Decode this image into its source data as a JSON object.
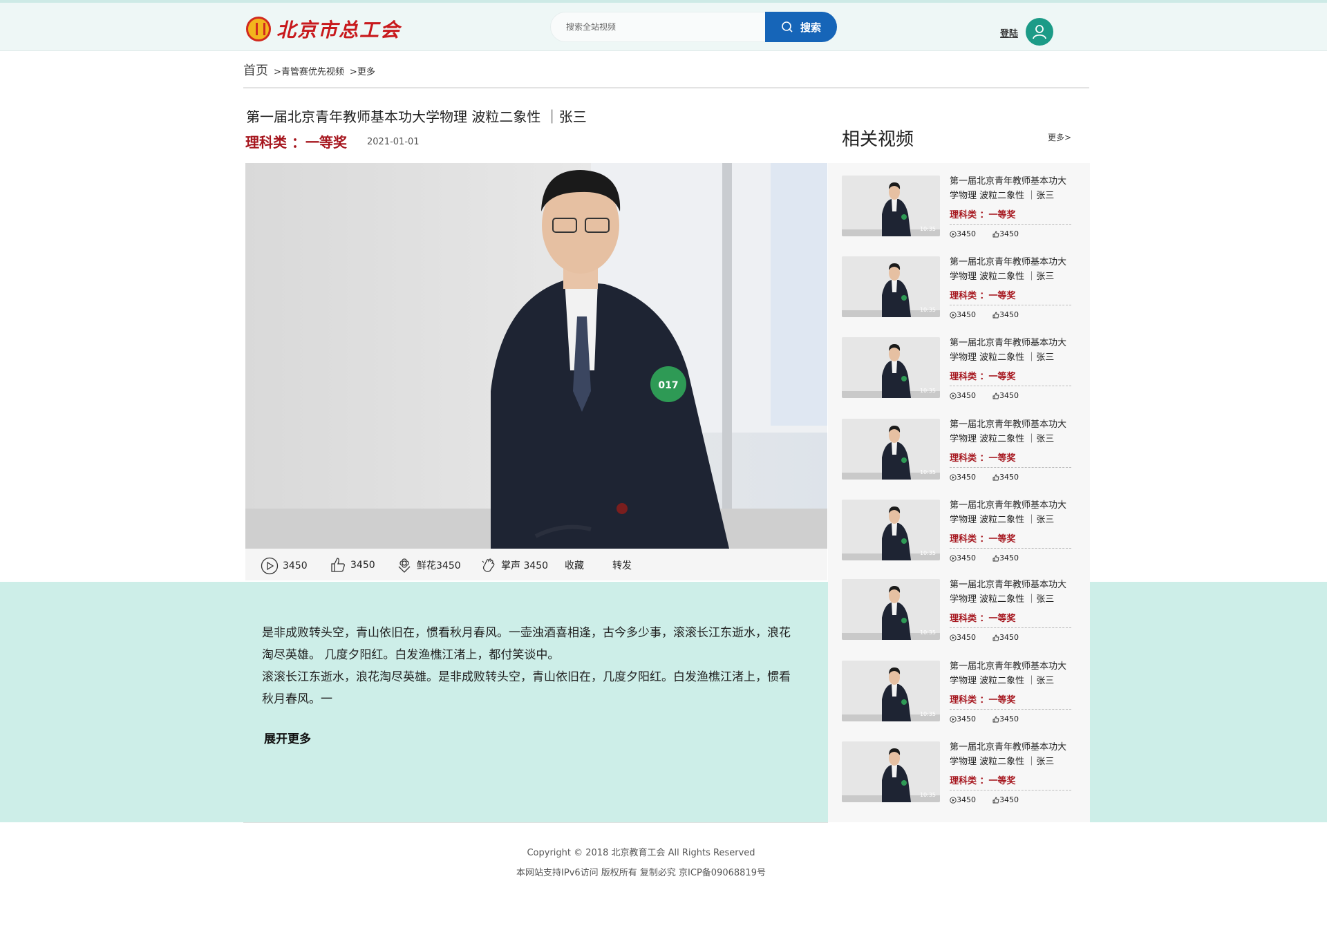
{
  "header": {
    "logo_text": "北京市总工会",
    "search_placeholder": "搜索全站视频",
    "search_label": "搜索",
    "login_label": "登陆"
  },
  "breadcrumb": {
    "home": "首页",
    "items": [
      "青管赛优先视频",
      "更多"
    ]
  },
  "video": {
    "title": "第一届北京青年教师基本功大学物理 波粒二象性 ｜张三",
    "category": "理科类 ：一等奖",
    "date": "2021-01-01",
    "badge_text": "017"
  },
  "stats": {
    "plays": "3450",
    "likes": "3450",
    "flowers": "鲜花3450",
    "applause": "掌声 3450",
    "favorite": "收藏",
    "share": "转发"
  },
  "description": {
    "text": "是非成败转头空，青山依旧在，惯看秋月春风。一壶浊酒喜相逢，古今多少事，滚滚长江东逝水，浪花淘尽英雄。 几度夕阳红。白发渔樵江渚上，都付笑谈中。\n滚滚长江东逝水，浪花淘尽英雄。是非成败转头空，青山依旧在，几度夕阳红。白发渔樵江渚上，惯看秋月春风。一",
    "expand_label": "展开更多"
  },
  "sidebar": {
    "title": "相关视频",
    "more_label": "更多>",
    "items": [
      {
        "title": "第一届北京青年教师基本功大学物理 波粒二象性 ｜张三",
        "category": "理科类 ：一等奖",
        "plays": "3450",
        "likes": "3450",
        "duration": "10:35"
      },
      {
        "title": "第一届北京青年教师基本功大学物理 波粒二象性 ｜张三",
        "category": "理科类 ：一等奖",
        "plays": "3450",
        "likes": "3450",
        "duration": "10:35"
      },
      {
        "title": "第一届北京青年教师基本功大学物理 波粒二象性 ｜张三",
        "category": "理科类 ：一等奖",
        "plays": "3450",
        "likes": "3450",
        "duration": "10:35"
      },
      {
        "title": "第一届北京青年教师基本功大学物理 波粒二象性 ｜张三",
        "category": "理科类 ：一等奖",
        "plays": "3450",
        "likes": "3450",
        "duration": "10:35"
      },
      {
        "title": "第一届北京青年教师基本功大学物理 波粒二象性 ｜张三",
        "category": "理科类 ：一等奖",
        "plays": "3450",
        "likes": "3450",
        "duration": "10:35"
      },
      {
        "title": "第一届北京青年教师基本功大学物理 波粒二象性 ｜张三",
        "category": "理科类 ：一等奖",
        "plays": "3450",
        "likes": "3450",
        "duration": "10:35"
      },
      {
        "title": "第一届北京青年教师基本功大学物理 波粒二象性 ｜张三",
        "category": "理科类 ：一等奖",
        "plays": "3450",
        "likes": "3450",
        "duration": "10:35"
      },
      {
        "title": "第一届北京青年教师基本功大学物理 波粒二象性 ｜张三",
        "category": "理科类 ：一等奖",
        "plays": "3450",
        "likes": "3450",
        "duration": "10:35"
      }
    ]
  },
  "footer": {
    "copyright": "Copyright © 2018 北京教育工会 All Rights Reserved",
    "icp": "本网站支持IPv6访问 版权所有 复制必究 京ICP备09068819号"
  },
  "colors": {
    "accent_blue": "#1665b8",
    "award_red": "#a6161e",
    "band_mint": "#cdeee8",
    "avatar_green": "#1c9b87"
  }
}
